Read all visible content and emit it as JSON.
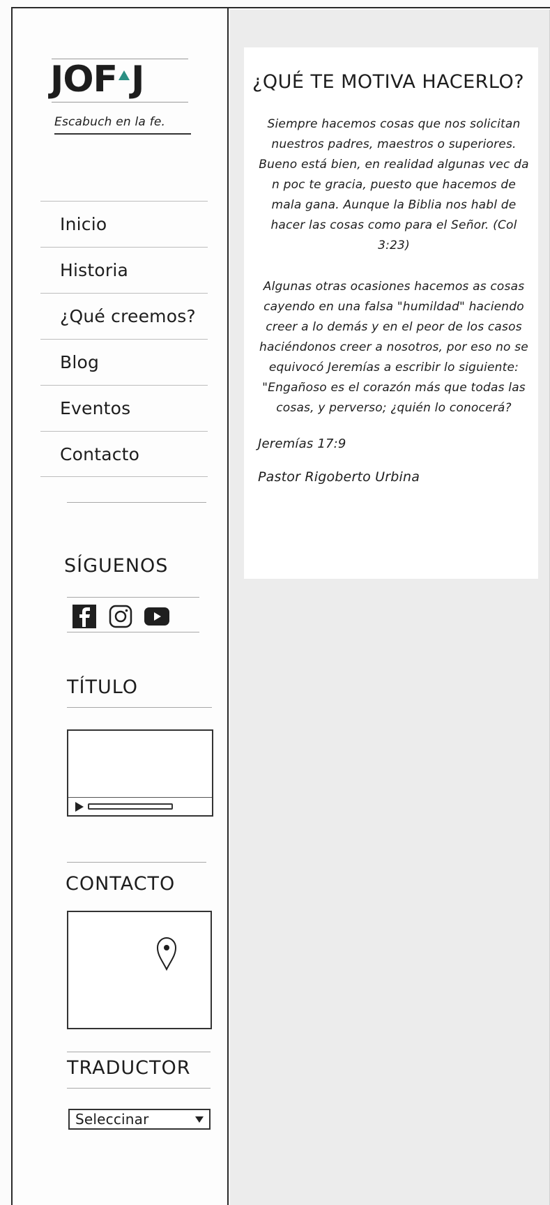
{
  "logo": {
    "text_left": "JOF",
    "text_right": "J"
  },
  "tagline": "Escabuch en la fe.",
  "nav": {
    "items": [
      {
        "label": "Inicio"
      },
      {
        "label": "Historia"
      },
      {
        "label": "¿Qué creemos?"
      },
      {
        "label": "Blog"
      },
      {
        "label": "Eventos"
      },
      {
        "label": "Contacto"
      }
    ]
  },
  "widgets": {
    "social_title": "SÍGUENOS",
    "social_icons": [
      "facebook-icon",
      "instagram-icon",
      "youtube-icon"
    ],
    "video_title": "TÍTULO",
    "contact_title": "CONTACTO",
    "translator_title": "TRADUCTOR",
    "translator_select": "Seleccinar"
  },
  "article": {
    "title": "¿QUÉ TE MOTIVA HACERLO?",
    "paragraph1": "Siempre hacemos cosas que nos solicitan nuestros padres, maestros o superiores. Bueno está bien, en realidad algunas vec da n poc te gracia, puesto que hacemos de mala gana. Aunque la Biblia nos habl de hacer las cosas como para el Señor. (Col 3:23)",
    "paragraph2": "Algunas otras ocasiones hacemos as cosas cayendo en una falsa \"humildad\" haciendo creer a lo demás y en el peor de los casos haciéndonos creer a nosotros, por eso no se equivocó Jeremías a escribir lo siguiente: \"Engañoso es el corazón más que todas las cosas, y perverso; ¿quién lo conocerá?",
    "citation": "Jeremías 17:9",
    "author": "Pastor Rigoberto Urbina"
  },
  "colors": {
    "accent": "#2b8f83",
    "ink": "#1d1d1d",
    "content_bg": "#ececec"
  }
}
